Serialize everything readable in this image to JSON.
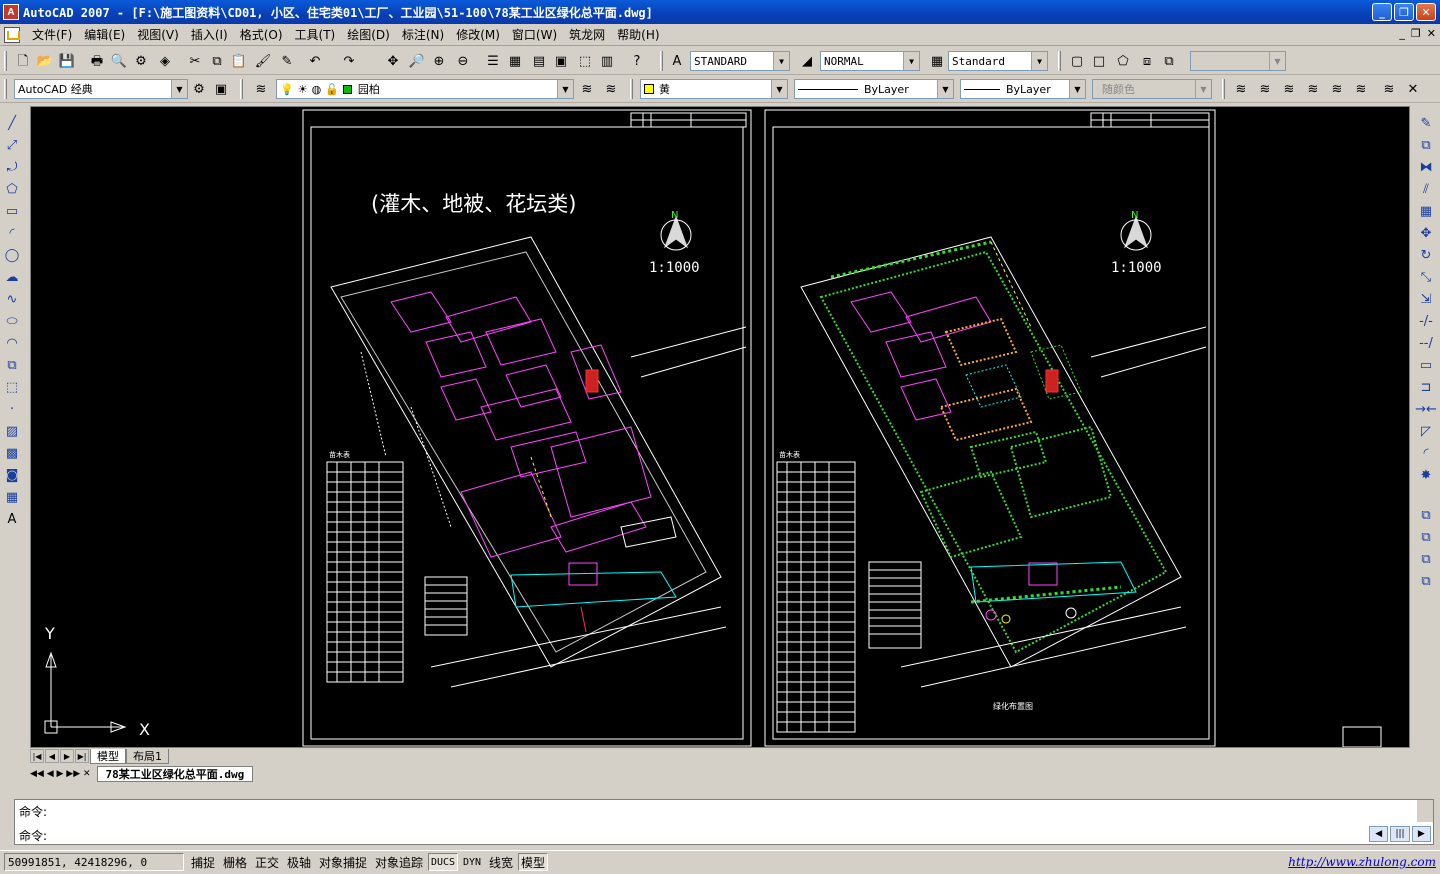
{
  "window": {
    "title": "AutoCAD 2007 - [F:\\施工图资料\\CD01, 小区、住宅类01\\工厂、工业园\\51-100\\78某工业区绿化总平面.dwg]",
    "app_icon_label": "A",
    "minimize": "_",
    "restore": "❐",
    "close": "✕"
  },
  "menu": {
    "items": [
      "文件(F)",
      "编辑(E)",
      "视图(V)",
      "插入(I)",
      "格式(O)",
      "工具(T)",
      "绘图(D)",
      "标注(N)",
      "修改(M)",
      "窗口(W)",
      "筑龙网",
      "帮助(H)"
    ],
    "mdi_minimize": "_",
    "mdi_restore": "❐",
    "mdi_close": "✕"
  },
  "toolbar": {
    "text_style": "STANDARD",
    "dim_style": "NORMAL",
    "table_style": "Standard",
    "workspace": "AutoCAD 经典",
    "layer": "园柏",
    "color": "黄",
    "linetype": "ByLayer",
    "lineweight": "ByLayer",
    "plot_style": "随颜色",
    "color_hex": "#ffff00"
  },
  "drawing": {
    "left_heading": "(灌木、地被、花坛类)",
    "left_scale": "1:1000",
    "right_scale": "1:1000",
    "north_label": "N",
    "right_caption": "绿化布置图",
    "left_table_title": "苗木表",
    "right_table_title": "苗木表",
    "ucs_x": "X",
    "ucs_y": "Y"
  },
  "layout_tabs": {
    "model": "模型",
    "layout1": "布局1"
  },
  "file_tabs": {
    "nav": "◀◀ ◀ ▶ ▶▶ ✕",
    "active": "78某工业区绿化总平面.dwg"
  },
  "command": {
    "line1": "命令:",
    "line2": "命令:"
  },
  "status": {
    "coords": "50991851, 42418296, 0",
    "buttons": [
      "捕捉",
      "栅格",
      "正交",
      "极轴",
      "对象捕捉",
      "对象追踪",
      "DUCS",
      "DYN",
      "线宽",
      "模型"
    ],
    "url": "http://www.zhulong.com"
  },
  "colors": {
    "title_blue": "#0840b8",
    "canvas_bg": "#000000",
    "site_magenta": "#ff00ff",
    "green_plants": "#33dd33",
    "cyan": "#00ffff"
  }
}
